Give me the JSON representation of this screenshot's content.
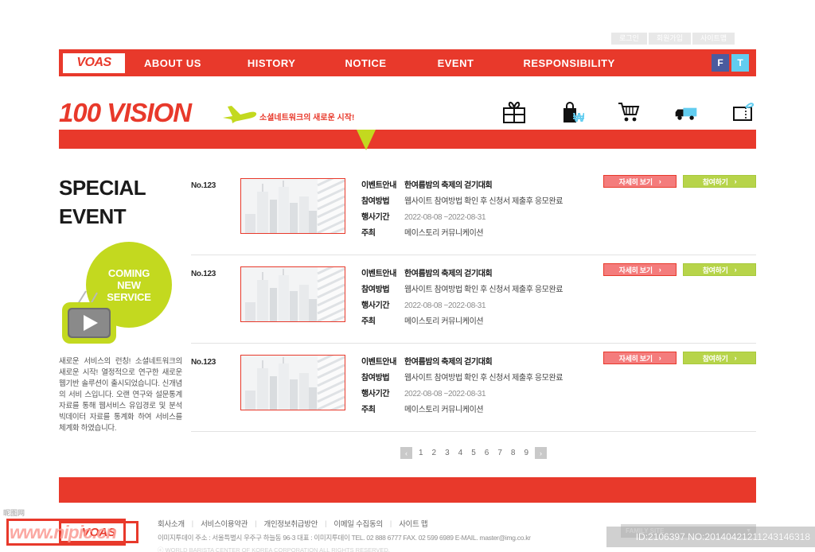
{
  "utility": {
    "items": [
      {
        "label": "로그인",
        "name": "login"
      },
      {
        "label": "회원가입",
        "name": "signup"
      },
      {
        "label": "사이트맵",
        "name": "sitemap"
      }
    ]
  },
  "nav": {
    "logo": "VOAS",
    "links": [
      {
        "label": "ABOUT  US",
        "name": "about-us"
      },
      {
        "label": "HISTORY",
        "name": "history"
      },
      {
        "label": "NOTICE",
        "name": "notice"
      },
      {
        "label": "EVENT",
        "name": "event"
      },
      {
        "label": "RESPONSIBILITY",
        "name": "responsibility"
      }
    ],
    "social": [
      {
        "label": "F",
        "name": "facebook",
        "color": "#4a5b9e"
      },
      {
        "label": "T",
        "name": "twitter",
        "color": "#62cdf0"
      }
    ]
  },
  "brand": {
    "title": "100 VISION",
    "tagline": "소셜네트워크의 새로운 시작!",
    "icons": [
      {
        "name": "gift-box-icon"
      },
      {
        "name": "shopping-bag-won-icon"
      },
      {
        "name": "shopping-cart-icon"
      },
      {
        "name": "delivery-truck-icon"
      },
      {
        "name": "gift-book-icon"
      }
    ]
  },
  "sidebar": {
    "title_line1": "SPECIAL",
    "title_line2": "EVENT",
    "badge_line1": "COMING",
    "badge_line2": "NEW",
    "badge_line3": "SERVICE",
    "description": "새로운 서비스의 런칭! 소셜네트워크의 새로운 시작! 열정적으로 연구한 새로운 웹기반 솔루션이 출시되었습니다. 신개념의 서비 스입니다. 오랜 연구와 설문통계 자료를 통해 웹서비스 유입경로 및 분석 빅데이터 자료를 통계화 하여 서비스를 체계화 하였습니다."
  },
  "event_list": {
    "labels": {
      "guide": "이벤트안내",
      "method": "참여방법",
      "period": "행사기간",
      "host": "주최"
    },
    "buttons": {
      "detail": "자세히 보기",
      "join": "참여하기",
      "chevron": "›"
    },
    "items": [
      {
        "no": "No.123",
        "guide": "한여름밤의 축제의 걷기대회",
        "method": "웹사이트 참여방법 확인 후 신청서 제출후 응모완료",
        "period": "2022-08-08 ~2022-08-31",
        "host": "메이스토리 커뮤니케이션"
      },
      {
        "no": "No.123",
        "guide": "한여름밤의 축제의 걷기대회",
        "method": "웹사이트 참여방법 확인 후 신청서 제출후 응모완료",
        "period": "2022-08-08 ~2022-08-31",
        "host": "메이스토리 커뮤니케이션"
      },
      {
        "no": "No.123",
        "guide": "한여름밤의 축제의 걷기대회",
        "method": "웹사이트 참여방법 확인 후 신청서 제출후 응모완료",
        "period": "2022-08-08 ~2022-08-31",
        "host": "메이스토리 커뮤니케이션"
      }
    ]
  },
  "pagination": {
    "prev": "‹",
    "next": "›",
    "pages": [
      "1",
      "2",
      "3",
      "4",
      "5",
      "6",
      "7",
      "8",
      "9"
    ]
  },
  "footer": {
    "logo": "VOAS",
    "links": [
      {
        "label": "회사소개",
        "name": "company-info"
      },
      {
        "label": "서비스이용약관",
        "name": "terms-of-service"
      },
      {
        "label": "개인정보취급방안",
        "name": "privacy-policy"
      },
      {
        "label": "이메일 수집동의",
        "name": "email-consent"
      },
      {
        "label": "사이트 맵",
        "name": "sitemap"
      }
    ],
    "separator": "|",
    "address": "이미지투데이    주소 : 서울특별시 우주구 하늘동 96-3   대표 : 이미지투데이  TEL. 02 888 6777  FAX. 02 599 6989 E-MAIL. master@img.co.kr",
    "copyright": "ⓒ WORLD BARISTA CENTER OF KOREA CORPORATION ALL RIGHTS RESERVED.",
    "family_label": "FAMILY SITE",
    "family_caret": "▼"
  },
  "watermark": {
    "site": "www.nipic.cn",
    "prefix": "昵图网",
    "id_text": "ID:2106397 NO:20140421211243146318"
  },
  "colors": {
    "brand_red": "#e8392b",
    "accent_green": "#c3d91f",
    "btn_detail": "#f47c7c",
    "btn_join": "#b7d44a",
    "facebook": "#4a5b9e",
    "twitter": "#62cdf0"
  }
}
